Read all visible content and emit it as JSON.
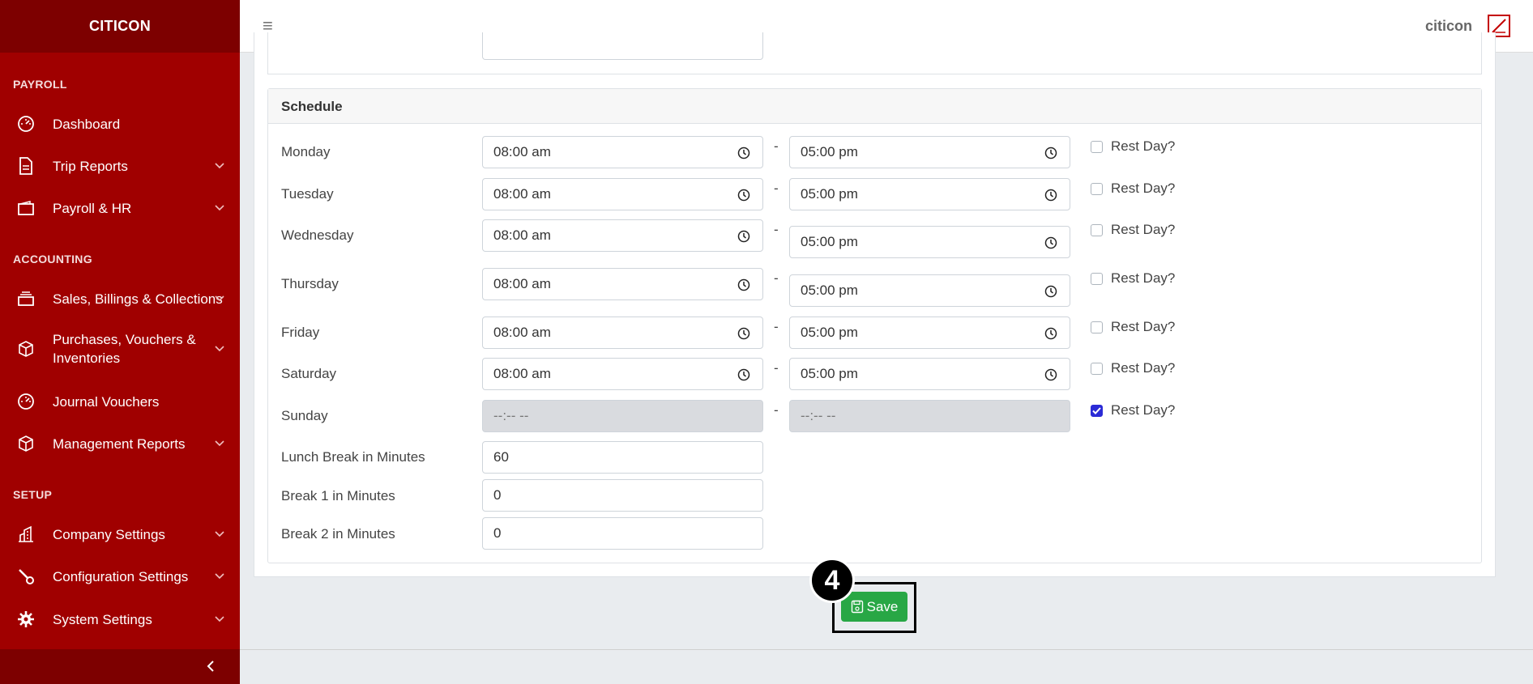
{
  "brand": "CITICON",
  "sidebar": {
    "sections": [
      {
        "title": "PAYROLL"
      },
      {
        "title": "ACCOUNTING"
      },
      {
        "title": "SETUP"
      }
    ],
    "items": [
      {
        "label": "Dashboard",
        "icon": "gauge-icon"
      },
      {
        "label": "Trip Reports",
        "icon": "file-icon"
      },
      {
        "label": "Payroll & HR",
        "icon": "wallet-icon"
      },
      {
        "label": "Sales, Billings & Collections",
        "icon": "layers-icon"
      },
      {
        "label": "Purchases, Vouchers & Inventories",
        "icon": "box-icon"
      },
      {
        "label": "Journal Vouchers",
        "icon": "gauge-icon"
      },
      {
        "label": "Management Reports",
        "icon": "box-icon"
      },
      {
        "label": "Company Settings",
        "icon": "building-icon"
      },
      {
        "label": "Configuration Settings",
        "icon": "wrench-icon"
      },
      {
        "label": "System Settings",
        "icon": "gear-icon"
      }
    ]
  },
  "header": {
    "user": "citicon"
  },
  "schedule": {
    "title": "Schedule",
    "days": [
      {
        "day": "Monday",
        "start": "08:00 am",
        "end": "05:00 pm",
        "rest_label": "Rest Day?",
        "rest": false
      },
      {
        "day": "Tuesday",
        "start": "08:00 am",
        "end": "05:00 pm",
        "rest_label": "Rest Day?",
        "rest": false
      },
      {
        "day": "Wednesday",
        "start": "08:00 am",
        "end": "05:00 pm",
        "rest_label": "Rest Day?",
        "rest": false
      },
      {
        "day": "Thursday",
        "start": "08:00 am",
        "end": "05:00 pm",
        "rest_label": "Rest Day?",
        "rest": false
      },
      {
        "day": "Friday",
        "start": "08:00 am",
        "end": "05:00 pm",
        "rest_label": "Rest Day?",
        "rest": false
      },
      {
        "day": "Saturday",
        "start": "08:00 am",
        "end": "05:00 pm",
        "rest_label": "Rest Day?",
        "rest": false
      },
      {
        "day": "Sunday",
        "start": "--:-- --",
        "end": "--:-- --",
        "rest_label": "Rest Day?",
        "rest": true
      }
    ],
    "separator": "-",
    "lunch": {
      "label": "Lunch Break in Minutes",
      "value": "60"
    },
    "break1": {
      "label": "Break 1 in Minutes",
      "value": "0"
    },
    "break2": {
      "label": "Break 2 in Minutes",
      "value": "0"
    }
  },
  "save_label": "Save",
  "step_badge": "4",
  "colors": {
    "sidebar": "#a00000",
    "sidebar_dark": "#7d0000",
    "save": "#28a745",
    "checkbox_checked": "#2b2bd6"
  }
}
